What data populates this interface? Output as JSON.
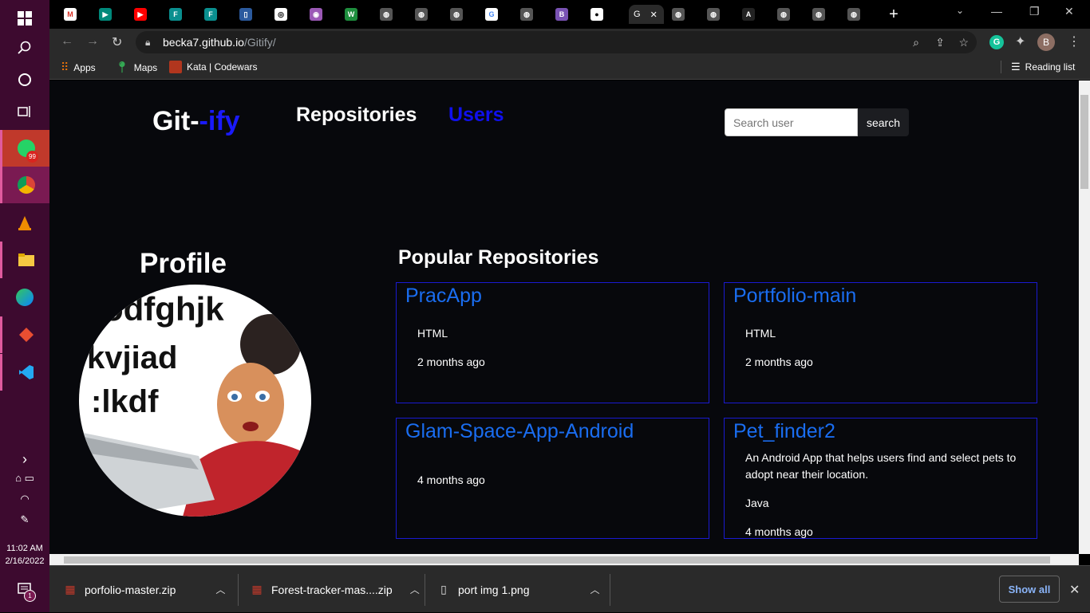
{
  "taskbar": {
    "badge_count": "99",
    "notif_count": "1",
    "time": "11:02 AM",
    "date": "2/16/2022"
  },
  "browser": {
    "active_tab_label": "G",
    "url_host": "becka7.github.io",
    "url_path": "/Gitify/",
    "profile_initial": "B",
    "reading_list": "Reading list",
    "bookmarks": [
      "Apps",
      "Maps",
      "Kata | Codewars"
    ]
  },
  "header": {
    "brand_main": "Git-",
    "brand_accent": "-ify",
    "nav_repos": "Repositories",
    "nav_users": "Users",
    "search_placeholder": "Search user",
    "search_button": "search"
  },
  "profile": {
    "title": "Profile"
  },
  "repos": {
    "title": "Popular Repositories",
    "items": [
      {
        "name": "PracApp",
        "description": "",
        "language": "HTML",
        "updated": "2 months ago"
      },
      {
        "name": "Portfolio-main",
        "description": "",
        "language": "HTML",
        "updated": "2 months ago"
      },
      {
        "name": "Glam-Space-App-Android",
        "description": "",
        "language": "",
        "updated": "4 months ago"
      },
      {
        "name": "Pet_finder2",
        "description": "An Android App that helps users find and select pets to adopt near their location.",
        "language": "Java",
        "updated": "4 months ago"
      }
    ]
  },
  "downloads": {
    "items": [
      "porfolio-master.zip",
      "Forest-tracker-mas....zip",
      "port img 1.png"
    ],
    "show_all": "Show all"
  },
  "colors": {
    "brand_accent": "#1a1aff",
    "repo_name": "#1a6df0",
    "card_border": "#1a1ad0",
    "page_bg": "#07080c"
  }
}
